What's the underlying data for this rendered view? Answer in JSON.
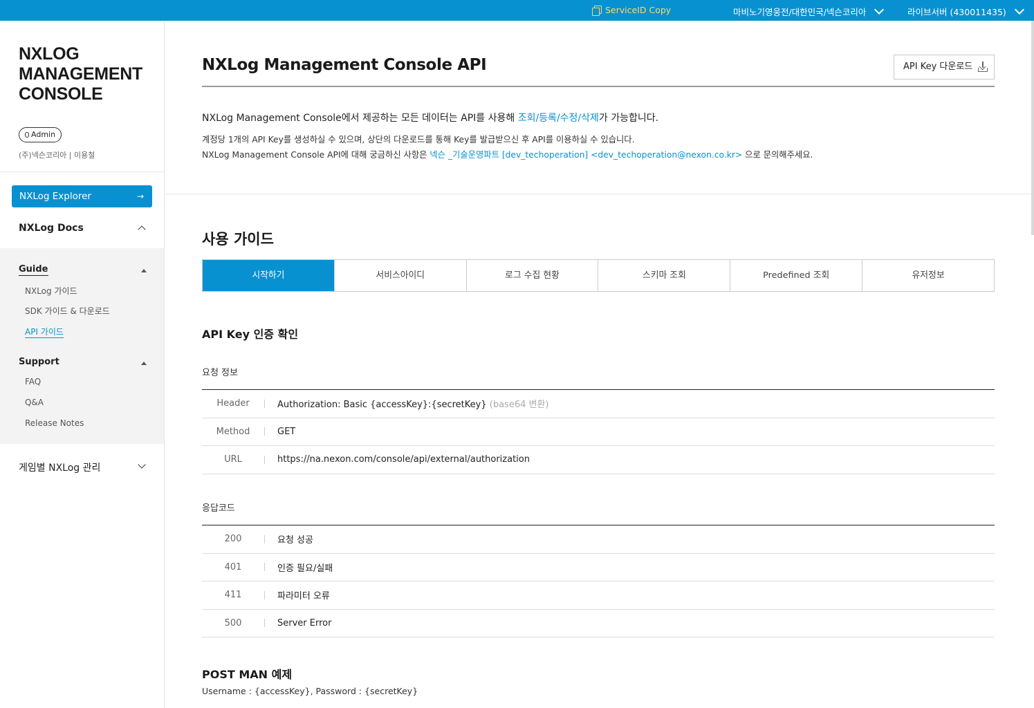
{
  "topbar": {
    "service_copy": "ServiceID Copy",
    "game_select": "마비노기영웅전/대한민국/넥슨코리아",
    "server_select": "라이브서버 (430011435)"
  },
  "sidebar": {
    "logo_lines": [
      "NXLOG",
      "MANAGEMENT",
      "CONSOLE"
    ],
    "role": "Admin",
    "user": "(주)넥슨코리아 | 이용철",
    "explorer_label": "NXLog Explorer",
    "docs_label": "NXLog Docs",
    "guide": {
      "title": "Guide",
      "items": [
        "NXLog 가이드",
        "SDK 가이드 & 다운로드",
        "API 가이드"
      ]
    },
    "support": {
      "title": "Support",
      "items": [
        "FAQ",
        "Q&A",
        "Release Notes"
      ]
    },
    "game_mgmt_label": "게임별 NXLog 관리"
  },
  "main": {
    "title": "NXLog Management Console API",
    "download_button": "API Key 다운로드",
    "intro": {
      "line1_pre": "NXLog Management Console에서 제공하는 모든 데이터는 API를 사용해 ",
      "line1_link": "조회/등록/수정/삭제",
      "line1_post": "가 가능합니다.",
      "line2": "계정당 1개의 API Key를 생성하실 수 있으며, 상단의 다운로드를 통해 Key를 발급받으신 후 API를 이용하실 수 있습니다.",
      "line3_pre": "NXLog Management Console API에 대해 궁금하신 사항은 ",
      "line3_link": "넥슨 _기술운영파트 [dev_techoperation] <dev_techoperation@nexon.co.kr>",
      "line3_post": " 으로 문의해주세요."
    },
    "guide_title": "사용 가이드",
    "tabs": [
      "시작하기",
      "서비스아이디",
      "로그 수집 현황",
      "스키마 조회",
      "Predefined 조회",
      "유저정보"
    ],
    "section_title": "API Key 인증 확인",
    "request_title": "요청 정보",
    "request_rows": [
      {
        "key": "Header",
        "value": "Authorization: Basic {accessKey}:{secretKey}",
        "note": "(base64 변환)"
      },
      {
        "key": "Method",
        "value": "GET",
        "note": ""
      },
      {
        "key": "URL",
        "value": "https://na.nexon.com/console/api/external/authorization",
        "note": ""
      }
    ],
    "response_title": "응답코드",
    "response_rows": [
      {
        "key": "200",
        "value": "요청 성공"
      },
      {
        "key": "401",
        "value": "인증 필요/실패"
      },
      {
        "key": "411",
        "value": "파라미터 오류"
      },
      {
        "key": "500",
        "value": "Server Error"
      }
    ],
    "postman_title": "POST MAN 예제",
    "postman_text": "Username : {accessKey}, Password : {secretKey}"
  },
  "colors": {
    "accent": "#0891d0",
    "service_copy": "#ffd966"
  }
}
